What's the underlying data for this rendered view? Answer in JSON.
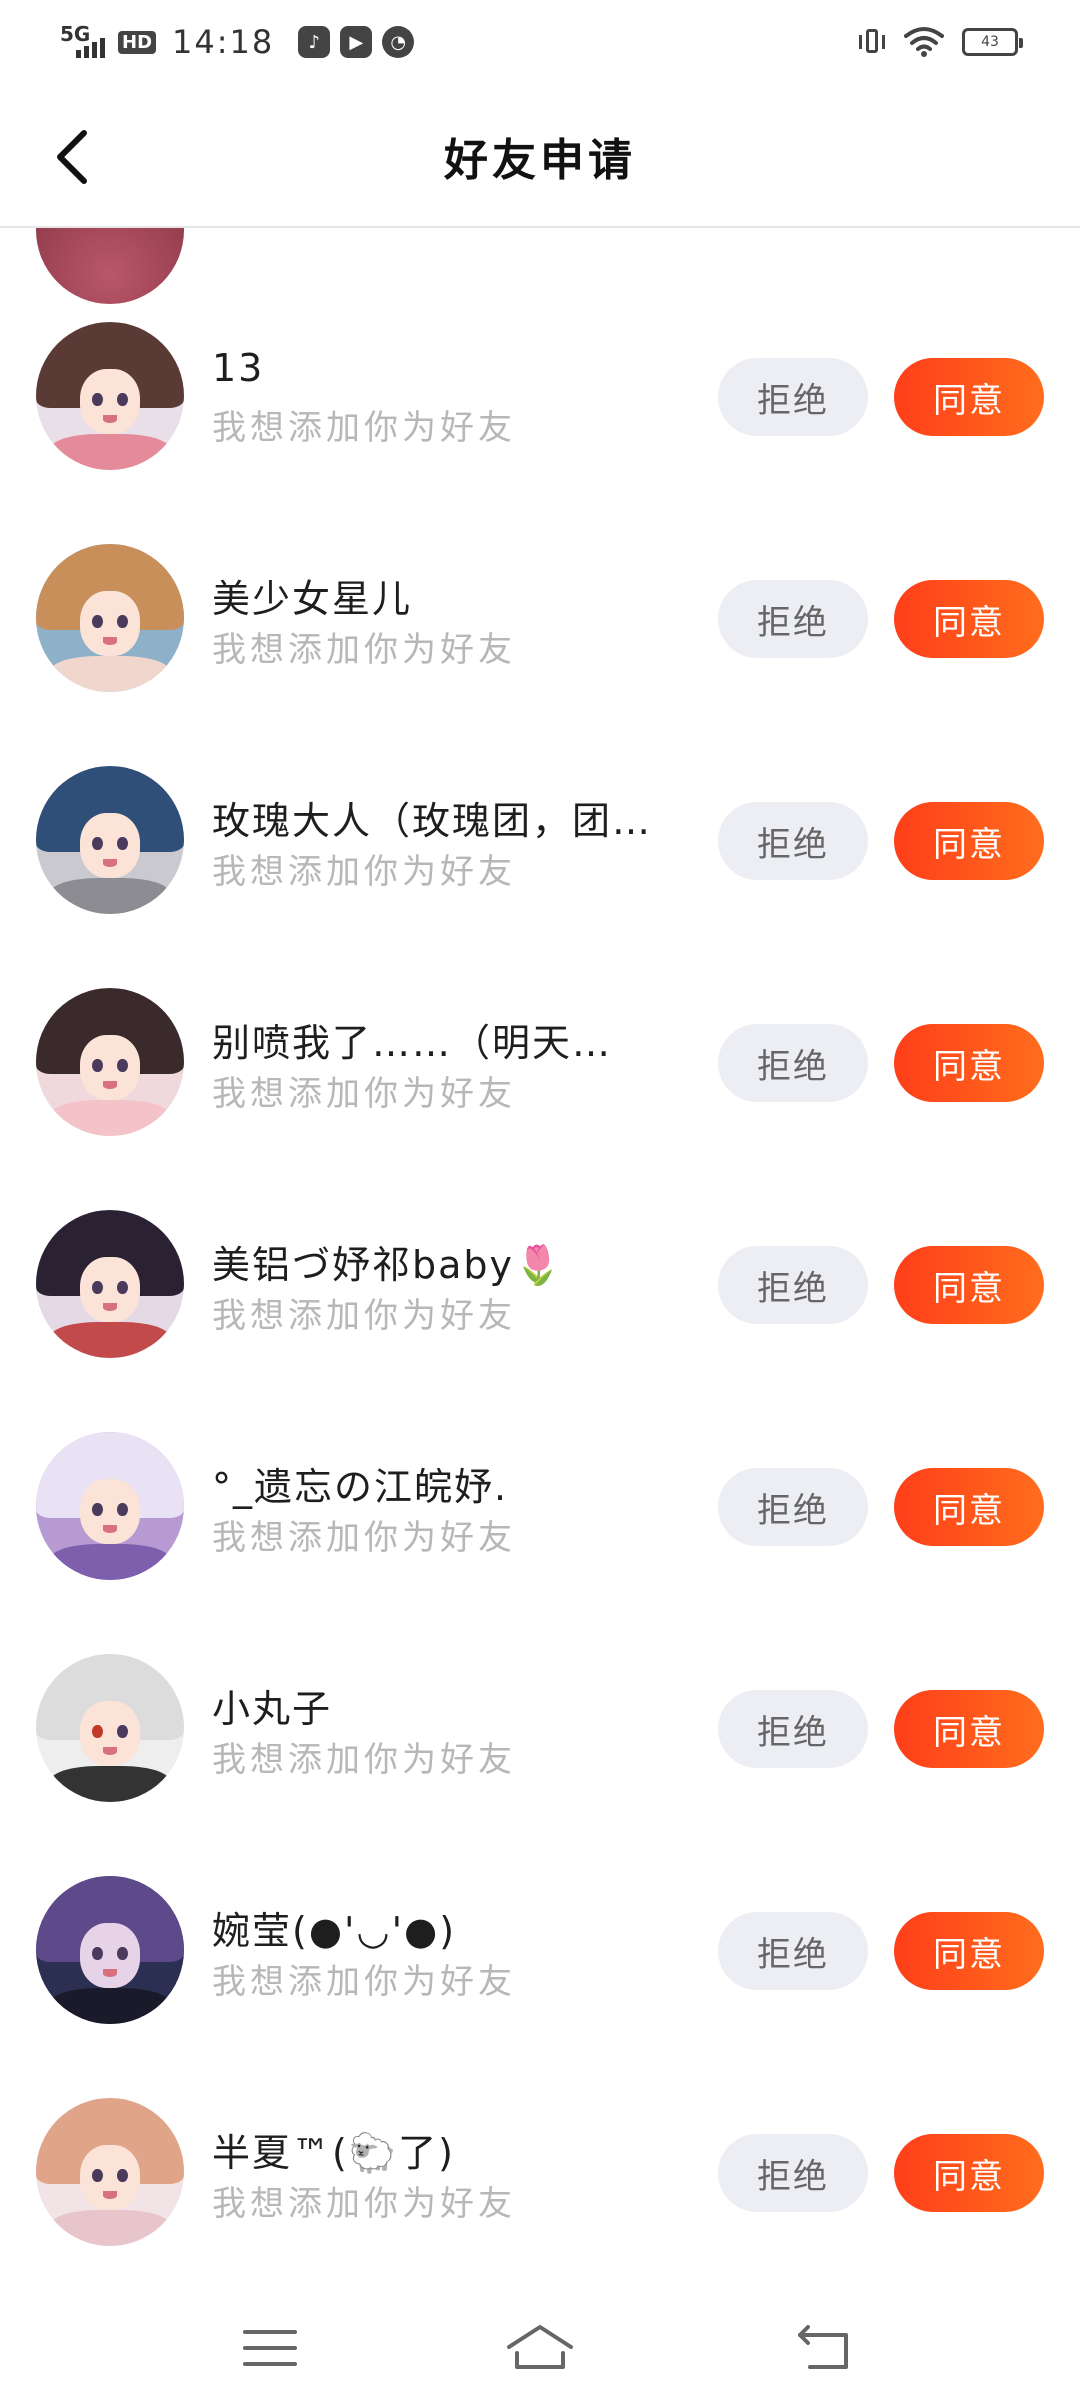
{
  "status_bar": {
    "network": "5G",
    "hd": "HD",
    "time": "14:18",
    "app_icons": [
      "tiktok-icon",
      "video-icon",
      "speed-icon"
    ],
    "battery": "43"
  },
  "header": {
    "title": "好友申请"
  },
  "requests": [
    {
      "name": "13",
      "message": "我想添加你为好友",
      "reject_label": "拒绝",
      "agree_label": "同意"
    },
    {
      "name": "美少女星儿",
      "message": "我想添加你为好友",
      "reject_label": "拒绝",
      "agree_label": "同意"
    },
    {
      "name": "玫瑰大人（玫瑰团，团…",
      "message": "我想添加你为好友",
      "reject_label": "拒绝",
      "agree_label": "同意"
    },
    {
      "name": "别喷我了……（明天…",
      "message": "我想添加你为好友",
      "reject_label": "拒绝",
      "agree_label": "同意"
    },
    {
      "name": "美铝づ妤祁baby🌷",
      "message": "我想添加你为好友",
      "reject_label": "拒绝",
      "agree_label": "同意"
    },
    {
      "name": "°_遗忘の江皖妤.",
      "message": "我想添加你为好友",
      "reject_label": "拒绝",
      "agree_label": "同意"
    },
    {
      "name": "小丸子",
      "message": "我想添加你为好友",
      "reject_label": "拒绝",
      "agree_label": "同意"
    },
    {
      "name": "婉莹(●'◡'●)",
      "message": "我想添加你为好友",
      "reject_label": "拒绝",
      "agree_label": "同意"
    },
    {
      "name": "半夏™(🐑了)",
      "message": "我想添加你为好友",
      "reject_label": "拒绝",
      "agree_label": "同意"
    }
  ],
  "colors": {
    "agree_gradient_start": "#ff3e1a",
    "agree_gradient_end": "#ff6d1c",
    "reject_bg": "#eceef3",
    "message_text": "#b7b7b7"
  },
  "bottom_nav": {
    "icons": [
      "menu-icon",
      "home-icon",
      "back-nav-icon"
    ]
  }
}
